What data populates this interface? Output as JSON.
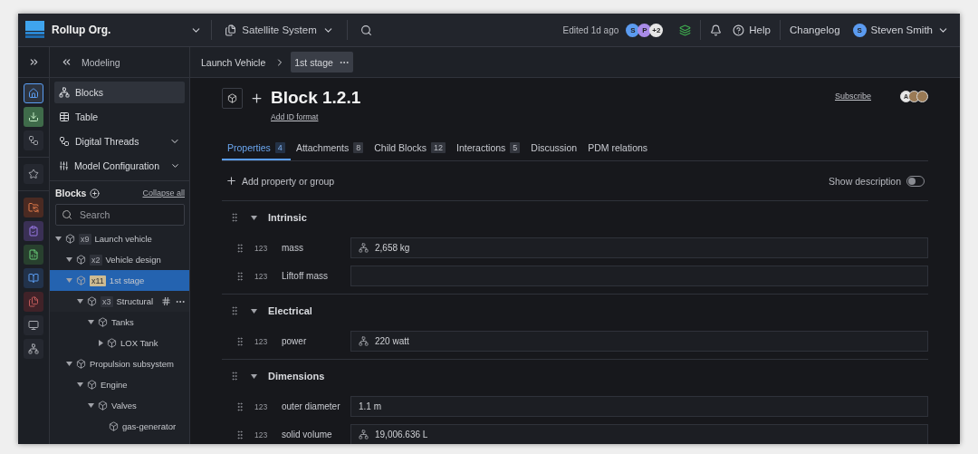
{
  "topbar": {
    "org": "Rollup Org.",
    "workspace": "Satellite System",
    "edited": "Edited 1d ago",
    "editors": [
      {
        "initial": "S",
        "color": "#5b9bf0"
      },
      {
        "initial": "P",
        "color": "#a98be8"
      },
      {
        "initial": "+2",
        "color": "#e6e6e6"
      }
    ],
    "help": "Help",
    "changelog": "Changelog",
    "user": {
      "initial": "S",
      "name": "Steven Smith",
      "color": "#5b9bf0"
    }
  },
  "rail": [
    {
      "kind": "home",
      "selected": true
    },
    {
      "kind": "download",
      "selected": false
    },
    {
      "kind": "threads",
      "selected": false
    },
    {
      "kind": "star",
      "selected": false
    },
    {
      "kind": "requirements",
      "selected": false
    },
    {
      "kind": "review",
      "selected": false
    },
    {
      "kind": "code",
      "selected": false
    },
    {
      "kind": "book",
      "selected": false
    },
    {
      "kind": "files",
      "selected": false
    },
    {
      "kind": "monitor",
      "selected": false
    },
    {
      "kind": "network",
      "selected": false
    }
  ],
  "sidebar": {
    "title": "Modeling",
    "nav": [
      {
        "label": "Blocks",
        "kind": "blocks",
        "selected": true,
        "expandable": false
      },
      {
        "label": "Table",
        "kind": "table",
        "selected": false,
        "expandable": false
      },
      {
        "label": "Digital Threads",
        "kind": "threads",
        "selected": false,
        "expandable": true
      },
      {
        "label": "Model Configuration",
        "kind": "config",
        "selected": false,
        "expandable": true
      }
    ],
    "blocks_title": "Blocks",
    "collapse_all": "Collapse all",
    "search": {
      "placeholder": "Search"
    },
    "tree": [
      {
        "label": "Launch vehicle",
        "count": "x9",
        "expanded": true,
        "selected": false,
        "hovered": false,
        "children": [
          {
            "label": "Vehicle design",
            "count": "x2",
            "expanded": true,
            "selected": false,
            "hovered": false
          },
          {
            "label": "1st stage",
            "count": "x11",
            "expanded": true,
            "selected": true,
            "hovered": false,
            "children": [
              {
                "label": "Structural",
                "count": "x3",
                "expanded": true,
                "selected": false,
                "hovered": true,
                "children": [
                  {
                    "label": "Tanks",
                    "expanded": true,
                    "selected": false,
                    "hovered": false,
                    "children": [
                      {
                        "label": "LOX Tank",
                        "expanded": false,
                        "selected": false,
                        "hovered": false
                      }
                    ]
                  }
                ]
              }
            ]
          },
          {
            "label": "Propulsion subsystem",
            "expanded": true,
            "selected": false,
            "hovered": false,
            "children": [
              {
                "label": "Engine",
                "expanded": true,
                "selected": false,
                "hovered": false,
                "children": [
                  {
                    "label": "Valves",
                    "expanded": true,
                    "selected": false,
                    "hovered": false,
                    "children": [
                      {
                        "label": "gas-generator",
                        "selected": false,
                        "hovered": false
                      }
                    ]
                  }
                ]
              }
            ]
          }
        ]
      }
    ]
  },
  "breadcrumb": [
    {
      "label": "Launch Vehicle",
      "selected": false
    },
    {
      "label": "1st stage",
      "selected": true
    }
  ],
  "header": {
    "title": "Block 1.2.1",
    "id_link": "Add ID format",
    "subscribe": "Subscribe",
    "watchers": [
      {
        "kind": "initial",
        "initial": "A"
      },
      {
        "kind": "photo"
      },
      {
        "kind": "photo"
      }
    ]
  },
  "tabs": [
    {
      "label": "Properties",
      "count": "4",
      "selected": true
    },
    {
      "label": "Attachments",
      "count": "8",
      "selected": false
    },
    {
      "label": "Child Blocks",
      "count": "12",
      "selected": false
    },
    {
      "label": "Interactions",
      "count": "5",
      "selected": false
    },
    {
      "label": "Discussion",
      "selected": false
    },
    {
      "label": "PDM relations",
      "selected": false
    }
  ],
  "add_property": "Add property or group",
  "show_description": {
    "label": "Show description",
    "on": false
  },
  "groups": [
    {
      "name": "Intrinsic",
      "expanded": true,
      "properties": [
        {
          "type": "123",
          "name": "mass",
          "value": "2,658 kg",
          "linked": true
        },
        {
          "type": "123",
          "name": "Liftoff mass",
          "linked": false
        }
      ]
    },
    {
      "name": "Electrical",
      "expanded": true,
      "properties": [
        {
          "type": "123",
          "name": "power",
          "value": "220 watt",
          "linked": true
        }
      ]
    },
    {
      "name": "Dimensions",
      "expanded": true,
      "properties": [
        {
          "type": "123",
          "name": "outer diameter",
          "value": "1.1 m",
          "linked": false
        },
        {
          "type": "123",
          "name": "solid volume",
          "value": "19,006.636 L",
          "linked": true
        }
      ]
    }
  ]
}
